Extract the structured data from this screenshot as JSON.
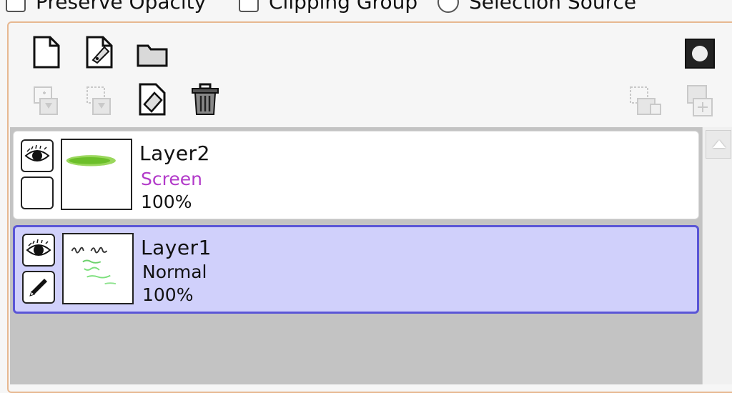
{
  "options": {
    "preserve_opacity": "Preserve Opacity",
    "clipping_group": "Clipping Group",
    "selection_source": "Selection Source"
  },
  "toolbar": {
    "row1": [
      "new-layer-icon",
      "new-linework-layer-icon",
      "new-folder-icon",
      "mask-icon"
    ],
    "row2": [
      "transfer-down-icon",
      "merge-down-icon",
      "clear-layer-icon",
      "delete-layer-icon",
      "merge-selection-icon",
      "add-mask-icon"
    ]
  },
  "layers": [
    {
      "name": "Layer2",
      "mode": "Screen",
      "mode_color": "#b23ac9",
      "opacity": "100%",
      "visible": true,
      "selected": false
    },
    {
      "name": "Layer1",
      "mode": "Normal",
      "mode_color": "#111111",
      "opacity": "100%",
      "visible": true,
      "selected": true
    }
  ],
  "colors": {
    "selected_bg": "#d0d0fb",
    "selected_border": "#5a55d6",
    "panel_border": "#e7b891"
  }
}
